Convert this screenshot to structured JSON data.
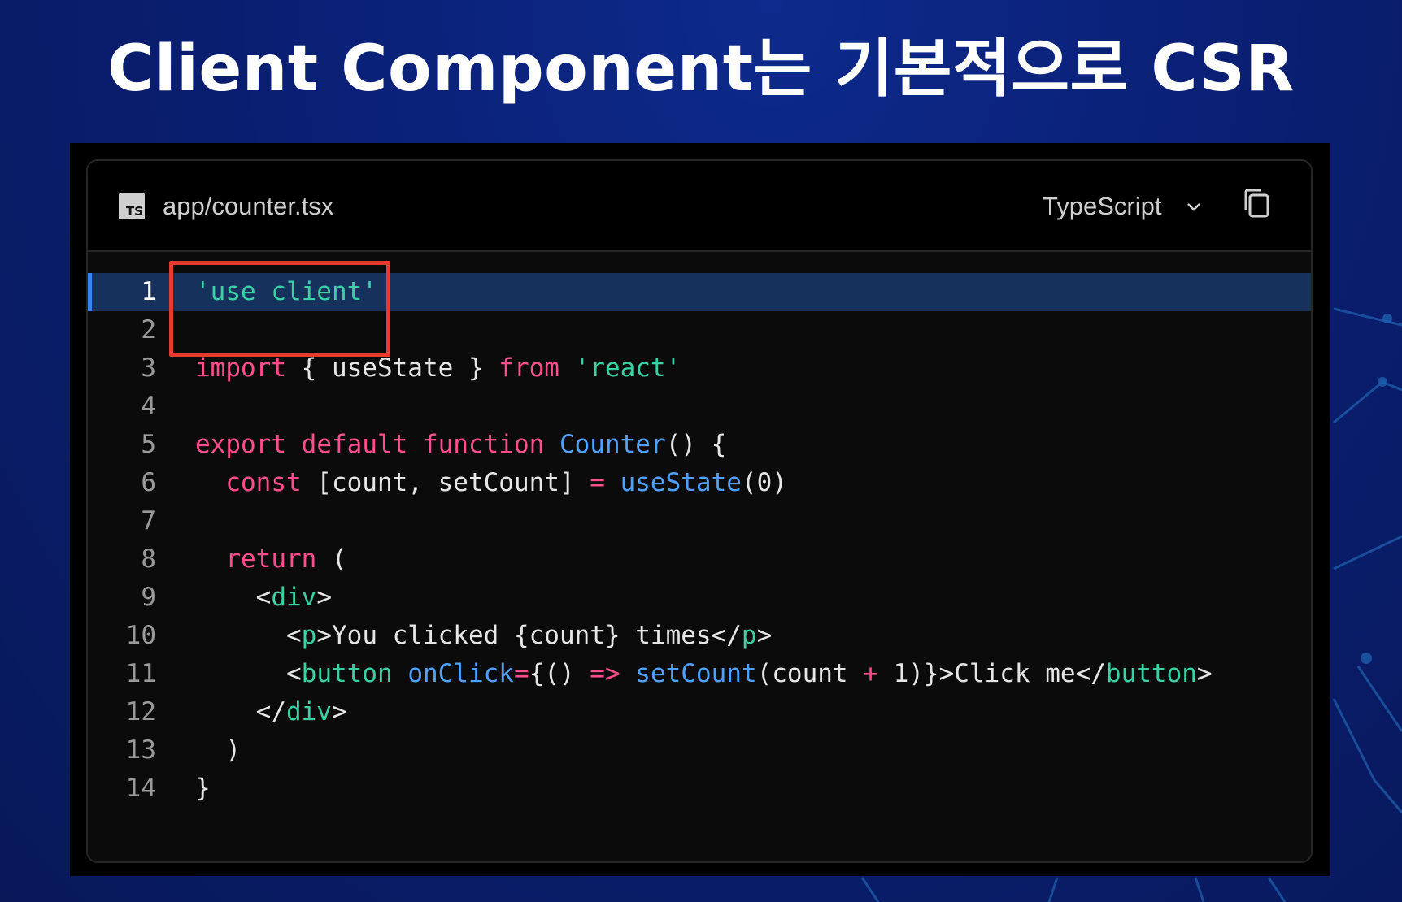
{
  "slide": {
    "title": "Client Component는 기본적으로 CSR"
  },
  "editor": {
    "filename": "app/counter.tsx",
    "file_icon_label": "TS",
    "language": "TypeScript",
    "icons": {
      "file": "ts-file-icon",
      "dropdown": "chevron-down-icon",
      "copy": "copy-icon"
    },
    "active_line": 1,
    "lines": [
      {
        "num": "1",
        "tokens": [
          {
            "t": "'use client'",
            "c": "str"
          }
        ]
      },
      {
        "num": "2",
        "tokens": []
      },
      {
        "num": "3",
        "tokens": [
          {
            "t": "import",
            "c": "kw"
          },
          {
            "t": " { useState } ",
            "c": "pl"
          },
          {
            "t": "from",
            "c": "kw"
          },
          {
            "t": " ",
            "c": "pl"
          },
          {
            "t": "'react'",
            "c": "str"
          }
        ]
      },
      {
        "num": "4",
        "tokens": []
      },
      {
        "num": "5",
        "tokens": [
          {
            "t": "export",
            "c": "kw"
          },
          {
            "t": " ",
            "c": "pl"
          },
          {
            "t": "default",
            "c": "kw"
          },
          {
            "t": " ",
            "c": "pl"
          },
          {
            "t": "function",
            "c": "kw"
          },
          {
            "t": " ",
            "c": "pl"
          },
          {
            "t": "Counter",
            "c": "fn"
          },
          {
            "t": "() {",
            "c": "pl"
          }
        ]
      },
      {
        "num": "6",
        "tokens": [
          {
            "t": "  ",
            "c": "pl"
          },
          {
            "t": "const",
            "c": "kw"
          },
          {
            "t": " [count, setCount] ",
            "c": "pl"
          },
          {
            "t": "=",
            "c": "op"
          },
          {
            "t": " ",
            "c": "pl"
          },
          {
            "t": "useState",
            "c": "fn"
          },
          {
            "t": "(0)",
            "c": "pl"
          }
        ]
      },
      {
        "num": "7",
        "tokens": []
      },
      {
        "num": "8",
        "tokens": [
          {
            "t": "  ",
            "c": "pl"
          },
          {
            "t": "return",
            "c": "kw"
          },
          {
            "t": " (",
            "c": "pl"
          }
        ]
      },
      {
        "num": "9",
        "tokens": [
          {
            "t": "    <",
            "c": "pl"
          },
          {
            "t": "div",
            "c": "tag"
          },
          {
            "t": ">",
            "c": "pl"
          }
        ]
      },
      {
        "num": "10",
        "tokens": [
          {
            "t": "      <",
            "c": "pl"
          },
          {
            "t": "p",
            "c": "tag"
          },
          {
            "t": ">You clicked {count} times</",
            "c": "pl"
          },
          {
            "t": "p",
            "c": "tag"
          },
          {
            "t": ">",
            "c": "pl"
          }
        ]
      },
      {
        "num": "11",
        "tokens": [
          {
            "t": "      <",
            "c": "pl"
          },
          {
            "t": "button",
            "c": "tag"
          },
          {
            "t": " ",
            "c": "pl"
          },
          {
            "t": "onClick",
            "c": "attr"
          },
          {
            "t": "=",
            "c": "op"
          },
          {
            "t": "{() ",
            "c": "pl"
          },
          {
            "t": "=>",
            "c": "op"
          },
          {
            "t": " ",
            "c": "pl"
          },
          {
            "t": "setCount",
            "c": "fn"
          },
          {
            "t": "(count ",
            "c": "pl"
          },
          {
            "t": "+",
            "c": "op"
          },
          {
            "t": " 1)}>Click me</",
            "c": "pl"
          },
          {
            "t": "button",
            "c": "tag"
          },
          {
            "t": ">",
            "c": "pl"
          }
        ]
      },
      {
        "num": "12",
        "tokens": [
          {
            "t": "    </",
            "c": "pl"
          },
          {
            "t": "div",
            "c": "tag"
          },
          {
            "t": ">",
            "c": "pl"
          }
        ]
      },
      {
        "num": "13",
        "tokens": [
          {
            "t": "  )",
            "c": "pl"
          }
        ]
      },
      {
        "num": "14",
        "tokens": [
          {
            "t": "}",
            "c": "pl"
          }
        ]
      }
    ]
  },
  "colors": {
    "background": "#0a1f73",
    "highlight_box": "#e63b2e",
    "keyword": "#ff4d8d",
    "string": "#3ad1a4",
    "function": "#4ea1ff",
    "active_line_bg": "#16325c"
  }
}
